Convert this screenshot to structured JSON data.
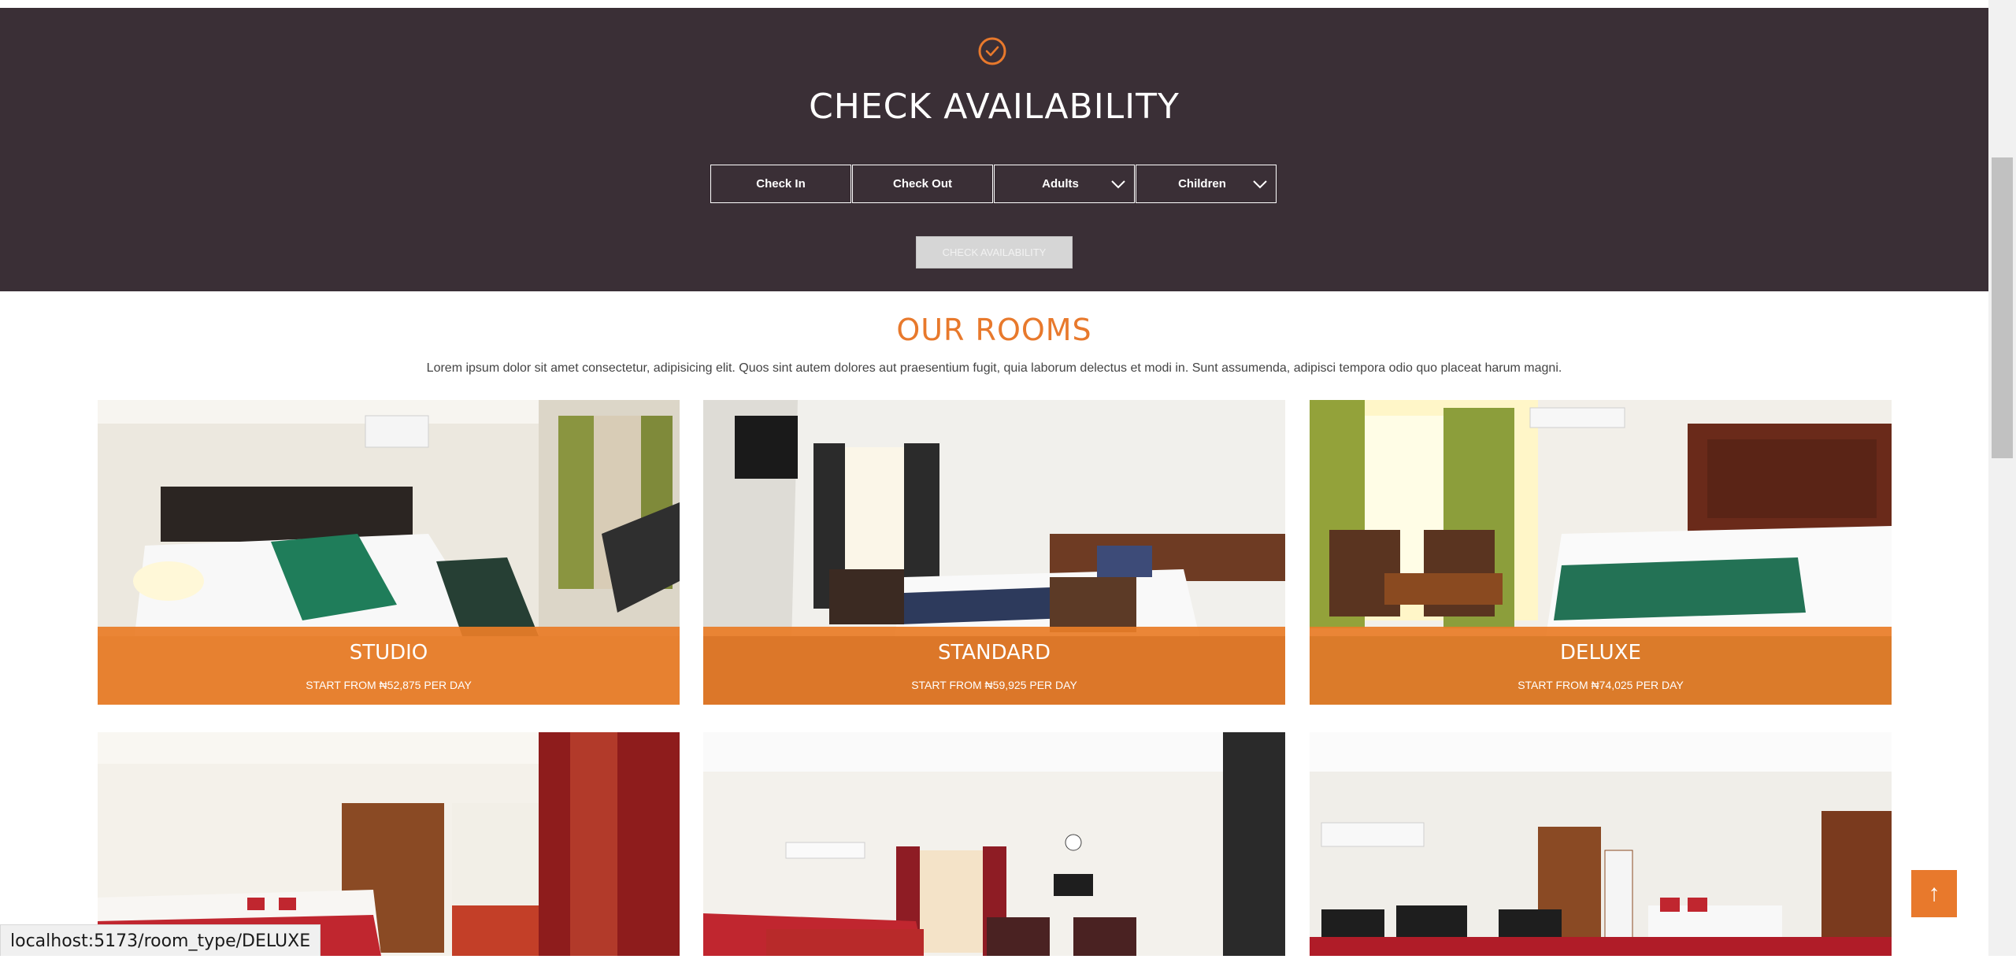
{
  "availability": {
    "title": "CHECK AVAILABILITY",
    "icon": "check-circle-icon",
    "check_in_label": "Check In",
    "check_out_label": "Check Out",
    "adults_label": "Adults",
    "children_label": "Children",
    "button_label": "CHECK AVAILABILITY"
  },
  "rooms": {
    "title": "OUR ROOMS",
    "description": "Lorem ipsum dolor sit amet consectetur, adipisicing elit. Quos sint autem dolores aut praesentium fugit, quia laborum delectus et modi in. Sunt assumenda, adipisci tempora odio quo placeat harum magni.",
    "cards": [
      {
        "name": "STUDIO",
        "price": "START FROM ₦52,875 PER DAY"
      },
      {
        "name": "STANDARD",
        "price": "START FROM ₦59,925 PER DAY"
      },
      {
        "name": "DELUXE",
        "price": "START FROM ₦74,025 PER DAY"
      }
    ]
  },
  "back_to_top": {
    "icon": "arrow-up-icon",
    "symbol": "↑"
  },
  "status_bar": {
    "url": "localhost:5173/room_type/DELUXE"
  },
  "colors": {
    "accent": "#e8792c",
    "dark_bg": "#3a2f36"
  }
}
